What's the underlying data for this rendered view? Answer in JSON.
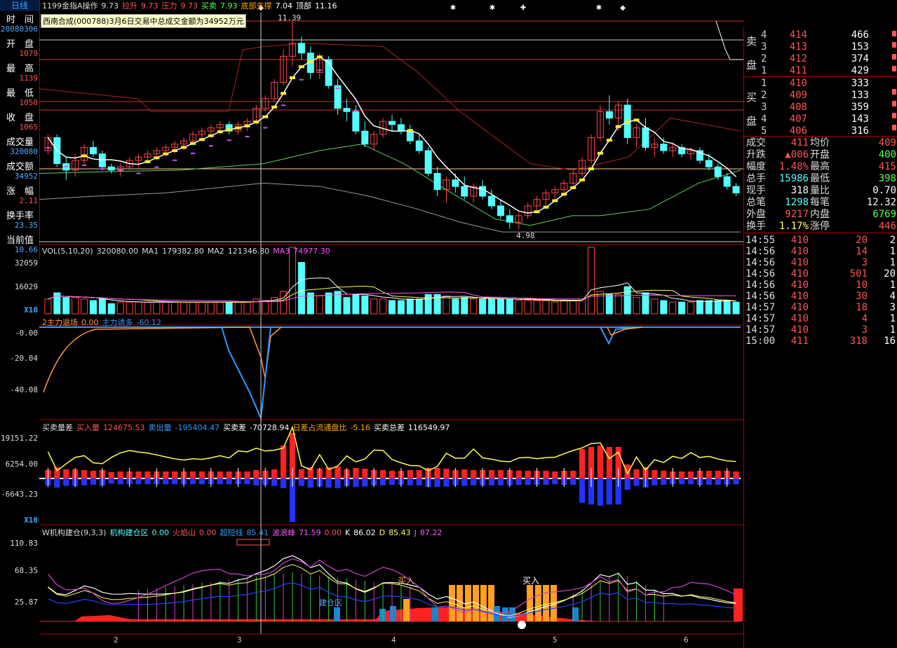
{
  "left_panel": {
    "tab": "日线",
    "items": [
      {
        "label": "时　间",
        "value": "20080306",
        "color": "#55aaff"
      },
      {
        "label": "开　盘",
        "value": "1079",
        "color": "#ff5555"
      },
      {
        "label": "最　高",
        "value": "1139",
        "color": "#ff5555"
      },
      {
        "label": "最　低",
        "value": "1050",
        "color": "#ff5555"
      },
      {
        "label": "收　盘",
        "value": "1065",
        "color": "#ff5555"
      },
      {
        "label": "成交量",
        "value": "320080",
        "color": "#55aaff"
      },
      {
        "label": "成交额",
        "value": "34952",
        "color": "#55aaff"
      },
      {
        "label": "涨　幅",
        "value": "2.11",
        "color": "#ff5555"
      },
      {
        "label": "换手率",
        "value": "23.35",
        "color": "#55aaff"
      },
      {
        "label": "当前值",
        "value": "10.66",
        "color": "#55aaff"
      }
    ]
  },
  "main_header": [
    {
      "text": "1199金指A操作",
      "color": "#dddddd"
    },
    {
      "text": "9.73",
      "color": "#dddddd"
    },
    {
      "text": "拉升",
      "color": "#ff5555"
    },
    {
      "text": "9.73",
      "color": "#ff5555"
    },
    {
      "text": "压力",
      "color": "#ff5555"
    },
    {
      "text": "9.73",
      "color": "#ff5555"
    },
    {
      "text": "买卖",
      "color": "#55ff55"
    },
    {
      "text": "7.93",
      "color": "#55ff55"
    },
    {
      "text": "底部支撑",
      "color": "#ffaa00"
    },
    {
      "text": "7.04",
      "color": "#ffffff"
    },
    {
      "text": "顶部",
      "color": "#ffffff"
    },
    {
      "text": "11.16",
      "color": "#ffffff"
    }
  ],
  "tooltip": "西南合成(000788)3月6日交易中总成交金额为34952万元",
  "price_labels": {
    "high": "11.39",
    "low": "4.98"
  },
  "vol_header": [
    {
      "text": "VOL(5,10,20)",
      "color": "#dddddd"
    },
    {
      "text": "320080.00",
      "color": "#dddddd"
    },
    {
      "text": "MA1",
      "color": "#dddddd"
    },
    {
      "text": "179382.80",
      "color": "#dddddd"
    },
    {
      "text": "MA2",
      "color": "#dddddd"
    },
    {
      "text": "121346.80",
      "color": "#dddddd"
    },
    {
      "text": "MA3",
      "color": "#ff55ff"
    },
    {
      "text": "74977.30",
      "color": "#ff55ff"
    }
  ],
  "vol_axis": [
    "32059",
    "16029",
    "X10"
  ],
  "capital_header": [
    {
      "text": "2主力退场",
      "color": "#ff9944"
    },
    {
      "text": "0.00",
      "color": "#ff9944"
    },
    {
      "text": "主力诱多",
      "color": "#3399ff"
    },
    {
      "text": "-60.12",
      "color": "#3399ff"
    }
  ],
  "capital_axis": [
    "-0.00",
    "-20.04",
    "-40.08"
  ],
  "trade_header": [
    {
      "text": "买卖量差",
      "color": "#dddddd"
    },
    {
      "text": "买入量",
      "color": "#ff5555"
    },
    {
      "text": "124675.53",
      "color": "#ff5555"
    },
    {
      "text": "卖出量",
      "color": "#3399ff"
    },
    {
      "text": "-195404.47",
      "color": "#3399ff"
    },
    {
      "text": "买卖差",
      "color": "#ffffff"
    },
    {
      "text": "-70728.94",
      "color": "#ffffff"
    },
    {
      "text": "日差占流通盘比",
      "color": "#ffaa00"
    },
    {
      "text": "-5.16",
      "color": "#ffaa00"
    },
    {
      "text": "买卖总差",
      "color": "#ffffff"
    },
    {
      "text": "116549.97",
      "color": "#ffffff"
    }
  ],
  "trade_axis": [
    "19151.22",
    "6254.00",
    "-6643.23",
    "X10"
  ],
  "inst_header": [
    {
      "text": "W机构建仓(9,3,3)",
      "color": "#dddddd"
    },
    {
      "text": "机构建仓区",
      "color": "#55ffff"
    },
    {
      "text": "0.00",
      "color": "#55ffff"
    },
    {
      "text": "火焰山",
      "color": "#ff5555"
    },
    {
      "text": "0.00",
      "color": "#ff5555"
    },
    {
      "text": "超短线",
      "color": "#3399ff"
    },
    {
      "text": "85.41",
      "color": "#3399ff"
    },
    {
      "text": "波浪峰",
      "color": "#ff55ff"
    },
    {
      "text": "71.59",
      "color": "#ff55ff"
    },
    {
      "text": "0.00",
      "color": "#ff5555"
    },
    {
      "text": "K",
      "color": "#ffffff"
    },
    {
      "text": "86.02",
      "color": "#ffffff"
    },
    {
      "text": "D",
      "color": "#ffff55"
    },
    {
      "text": "85.43",
      "color": "#ffff55"
    },
    {
      "text": "J",
      "color": "#ff55ff"
    },
    {
      "text": "87.22",
      "color": "#ff55ff"
    }
  ],
  "inst_axis": [
    "110.83",
    "68.35",
    "25.87"
  ],
  "inst_labels": {
    "buy1": "买入",
    "buy2": "买入",
    "zone": "建仓区"
  },
  "x_axis": [
    "2",
    "3",
    "4",
    "5",
    "6"
  ],
  "order_book": {
    "sell_label": [
      "卖",
      "盘"
    ],
    "buy_label": [
      "买",
      "盘"
    ],
    "sells": [
      {
        "n": "4",
        "price": "414",
        "vol": "466"
      },
      {
        "n": "3",
        "price": "413",
        "vol": "153"
      },
      {
        "n": "2",
        "price": "412",
        "vol": "374"
      },
      {
        "n": "1",
        "price": "411",
        "vol": "429"
      }
    ],
    "buys": [
      {
        "n": "1",
        "price": "410",
        "vol": "333"
      },
      {
        "n": "2",
        "price": "409",
        "vol": "133"
      },
      {
        "n": "3",
        "price": "408",
        "vol": "359"
      },
      {
        "n": "4",
        "price": "407",
        "vol": "143"
      },
      {
        "n": "5",
        "price": "406",
        "vol": "316"
      }
    ]
  },
  "stats": [
    {
      "l1": "成交",
      "v1": "411",
      "c1": "#ff5555",
      "l2": "均价",
      "v2": "409",
      "c2": "#ff5555"
    },
    {
      "l1": "升跌",
      "v1": "▲006",
      "c1": "#ff5555",
      "l2": "开盘",
      "v2": "400",
      "c2": "#55ff55"
    },
    {
      "l1": "幅度",
      "v1": "1.48%",
      "c1": "#ff5555",
      "l2": "最高",
      "v2": "415",
      "c2": "#ff5555"
    },
    {
      "l1": "总手",
      "v1": "15986",
      "c1": "#55ffff",
      "l2": "最低",
      "v2": "398",
      "c2": "#55ff55"
    },
    {
      "l1": "现手",
      "v1": "318",
      "c1": "#ffffff",
      "l2": "量比",
      "v2": "0.70",
      "c2": "#ffffff"
    },
    {
      "l1": "总笔",
      "v1": "1298",
      "c1": "#55ffff",
      "l2": "每笔",
      "v2": "12.32",
      "c2": "#ffffff"
    },
    {
      "l1": "外盘",
      "v1": "9217",
      "c1": "#ff5555",
      "l2": "内盘",
      "v2": "6769",
      "c2": "#55ff55"
    },
    {
      "l1": "换手",
      "v1": "1.17%",
      "c1": "#ffff55",
      "l2": "涨停",
      "v2": "446",
      "c2": "#ff5555"
    }
  ],
  "ticks": [
    {
      "t": "14:55",
      "p": "410",
      "v": "20",
      "n": "2"
    },
    {
      "t": "14:56",
      "p": "410",
      "v": "14",
      "n": "1"
    },
    {
      "t": "14:56",
      "p": "410",
      "v": "3",
      "n": "1"
    },
    {
      "t": "14:56",
      "p": "410",
      "v": "501",
      "n": "20"
    },
    {
      "t": "14:56",
      "p": "410",
      "v": "10",
      "n": "1"
    },
    {
      "t": "14:56",
      "p": "410",
      "v": "30",
      "n": "4"
    },
    {
      "t": "14:57",
      "p": "410",
      "v": "18",
      "n": "3"
    },
    {
      "t": "14:57",
      "p": "410",
      "v": "4",
      "n": "1"
    },
    {
      "t": "14:57",
      "p": "410",
      "v": "3",
      "n": "1"
    },
    {
      "t": "15:00",
      "p": "411",
      "v": "318",
      "n": "16"
    }
  ],
  "chart_data": {
    "type": "candlestick",
    "title": "1199金指A操作",
    "price_range": [
      4.98,
      11.39
    ],
    "candles": [
      [
        7.4,
        7.9,
        7.3,
        7.8
      ],
      [
        7.8,
        7.9,
        6.9,
        7.0
      ],
      [
        7.0,
        7.2,
        6.5,
        6.8
      ],
      [
        6.8,
        7.3,
        6.6,
        7.1
      ],
      [
        7.1,
        7.6,
        7.0,
        7.5
      ],
      [
        7.5,
        7.7,
        7.2,
        7.3
      ],
      [
        7.3,
        7.4,
        6.8,
        6.9
      ],
      [
        6.9,
        7.0,
        6.7,
        6.8
      ],
      [
        6.8,
        7.0,
        6.6,
        6.9
      ],
      [
        6.9,
        7.2,
        6.8,
        7.1
      ],
      [
        7.1,
        7.3,
        6.9,
        7.2
      ],
      [
        7.2,
        7.4,
        7.0,
        7.3
      ],
      [
        7.3,
        7.5,
        7.1,
        7.4
      ],
      [
        7.4,
        7.6,
        7.2,
        7.5
      ],
      [
        7.5,
        7.7,
        7.3,
        7.6
      ],
      [
        7.6,
        7.8,
        7.4,
        7.7
      ],
      [
        7.7,
        8.0,
        7.6,
        7.9
      ],
      [
        7.9,
        8.1,
        7.7,
        8.0
      ],
      [
        8.0,
        8.2,
        7.8,
        8.1
      ],
      [
        8.1,
        8.3,
        7.9,
        8.2
      ],
      [
        8.2,
        8.3,
        7.9,
        8.0
      ],
      [
        8.0,
        8.3,
        7.9,
        8.2
      ],
      [
        8.2,
        8.4,
        8.0,
        8.3
      ],
      [
        8.3,
        8.8,
        8.2,
        8.7
      ],
      [
        8.7,
        9.1,
        8.6,
        9.0
      ],
      [
        9.0,
        9.6,
        8.9,
        9.5
      ],
      [
        9.5,
        10.5,
        9.4,
        10.3
      ],
      [
        10.3,
        11.39,
        10.0,
        10.7
      ],
      [
        10.7,
        10.9,
        10.2,
        10.4
      ],
      [
        10.4,
        10.6,
        9.6,
        9.8
      ],
      [
        9.8,
        10.4,
        9.6,
        10.2
      ],
      [
        10.2,
        10.3,
        9.3,
        9.4
      ],
      [
        9.4,
        9.6,
        8.5,
        8.7
      ],
      [
        8.7,
        9.0,
        8.3,
        8.6
      ],
      [
        8.6,
        8.8,
        7.9,
        8.0
      ],
      [
        8.0,
        8.3,
        7.5,
        7.6
      ],
      [
        7.6,
        8.0,
        7.4,
        7.9
      ],
      [
        7.9,
        8.4,
        7.8,
        8.3
      ],
      [
        8.3,
        8.5,
        8.0,
        8.2
      ],
      [
        8.2,
        8.4,
        7.9,
        8.0
      ],
      [
        8.0,
        8.2,
        7.6,
        7.7
      ],
      [
        7.7,
        7.9,
        7.3,
        7.4
      ],
      [
        7.4,
        7.5,
        6.6,
        6.7
      ],
      [
        6.7,
        6.9,
        6.0,
        6.2
      ],
      [
        6.2,
        6.6,
        5.8,
        6.5
      ],
      [
        6.5,
        6.7,
        6.1,
        6.3
      ],
      [
        6.3,
        6.6,
        5.9,
        6.0
      ],
      [
        6.0,
        6.4,
        5.8,
        6.3
      ],
      [
        6.3,
        6.5,
        5.9,
        6.0
      ],
      [
        6.0,
        6.2,
        5.6,
        5.7
      ],
      [
        5.7,
        5.9,
        5.3,
        5.4
      ],
      [
        5.4,
        5.6,
        5.0,
        5.2
      ],
      [
        5.2,
        5.5,
        4.98,
        5.4
      ],
      [
        5.4,
        5.8,
        5.3,
        5.7
      ],
      [
        5.7,
        6.0,
        5.5,
        5.9
      ],
      [
        5.9,
        6.2,
        5.7,
        6.1
      ],
      [
        6.1,
        6.3,
        5.9,
        6.2
      ],
      [
        6.2,
        6.5,
        6.0,
        6.4
      ],
      [
        6.4,
        6.8,
        6.3,
        6.7
      ],
      [
        6.7,
        7.2,
        6.6,
        7.1
      ],
      [
        7.1,
        7.9,
        7.0,
        7.8
      ],
      [
        7.8,
        8.8,
        7.7,
        8.6
      ],
      [
        8.6,
        9.1,
        8.2,
        8.4
      ],
      [
        8.4,
        8.9,
        8.0,
        8.8
      ],
      [
        8.8,
        9.0,
        7.6,
        7.8
      ],
      [
        7.8,
        8.2,
        7.5,
        8.1
      ],
      [
        8.1,
        8.4,
        7.4,
        7.5
      ],
      [
        7.5,
        7.8,
        7.2,
        7.6
      ],
      [
        7.6,
        7.8,
        7.3,
        7.4
      ],
      [
        7.4,
        7.6,
        7.2,
        7.5
      ],
      [
        7.5,
        7.6,
        7.2,
        7.3
      ],
      [
        7.3,
        7.5,
        7.1,
        7.4
      ],
      [
        7.4,
        7.5,
        7.0,
        7.1
      ],
      [
        7.1,
        7.3,
        6.8,
        6.9
      ],
      [
        6.9,
        7.0,
        6.5,
        6.6
      ],
      [
        6.6,
        6.7,
        6.2,
        6.3
      ],
      [
        6.3,
        6.4,
        6.0,
        6.1
      ]
    ]
  }
}
